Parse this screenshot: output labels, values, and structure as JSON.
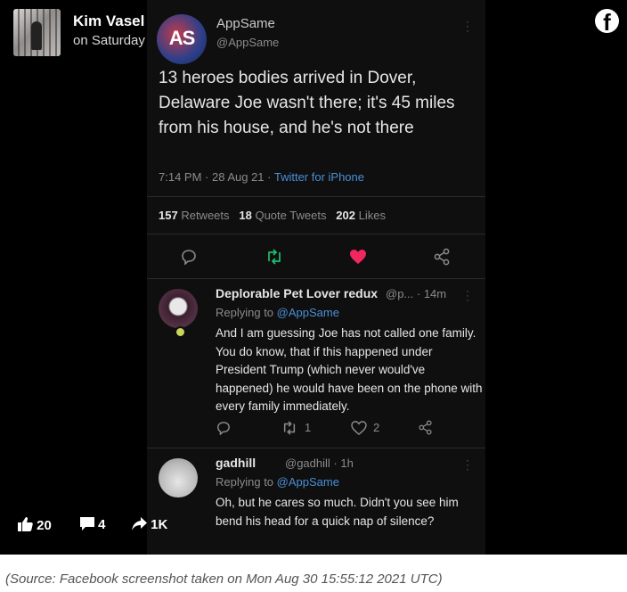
{
  "facebook": {
    "author_name": "Kim Vasel",
    "post_time": "on Saturday",
    "logo_glyph": "f",
    "stats": {
      "likes": "20",
      "comments": "4",
      "shares": "1K"
    }
  },
  "tweet": {
    "avatar_text": "AS",
    "name": "AppSame",
    "handle": "@AppSame",
    "text": "13 heroes bodies arrived in Dover, Delaware Joe wasn't there; it's 45 miles from his house, and he's not there",
    "time": "7:14 PM · 28 Aug 21 · ",
    "source": "Twitter for iPhone",
    "retweets_count": "157",
    "retweets_label": "Retweets",
    "quotes_count": "18",
    "quotes_label": "Quote Tweets",
    "likes_count": "202",
    "likes_label": "Likes"
  },
  "replies": [
    {
      "name": "Deplorable Pet Lover redux",
      "handle_time": "@p... · 14m",
      "replying_prefix": "Replying to ",
      "replying_to": "@AppSame",
      "text": "And I am guessing Joe has not called one family. You do know, that if this happened under President Trump (which never would've happened) he would have been on the phone with every family immediately.",
      "retweet_count": "1",
      "like_count": "2"
    },
    {
      "name": "gadhill",
      "handle_time": "@gadhill · 1h",
      "replying_prefix": "Replying to ",
      "replying_to": "@AppSame",
      "text": "Oh, but he cares so much. Didn't you see him bend his head for a quick nap of silence?"
    }
  ],
  "caption": "(Source: Facebook screenshot taken on Mon Aug 30 15:55:12 2021 UTC)",
  "colors": {
    "background": "#000000",
    "tweet_bg": "#0f0f0f",
    "link_blue": "#4a8fd6",
    "retweet_green": "#1fbf6e",
    "like_red": "#f2275f"
  },
  "icons": [
    "facebook-logo-icon",
    "more-icon",
    "reply-icon",
    "retweet-icon",
    "heart-icon",
    "share-icon",
    "thumbs-up-icon",
    "comment-icon",
    "share-arrow-icon"
  ]
}
